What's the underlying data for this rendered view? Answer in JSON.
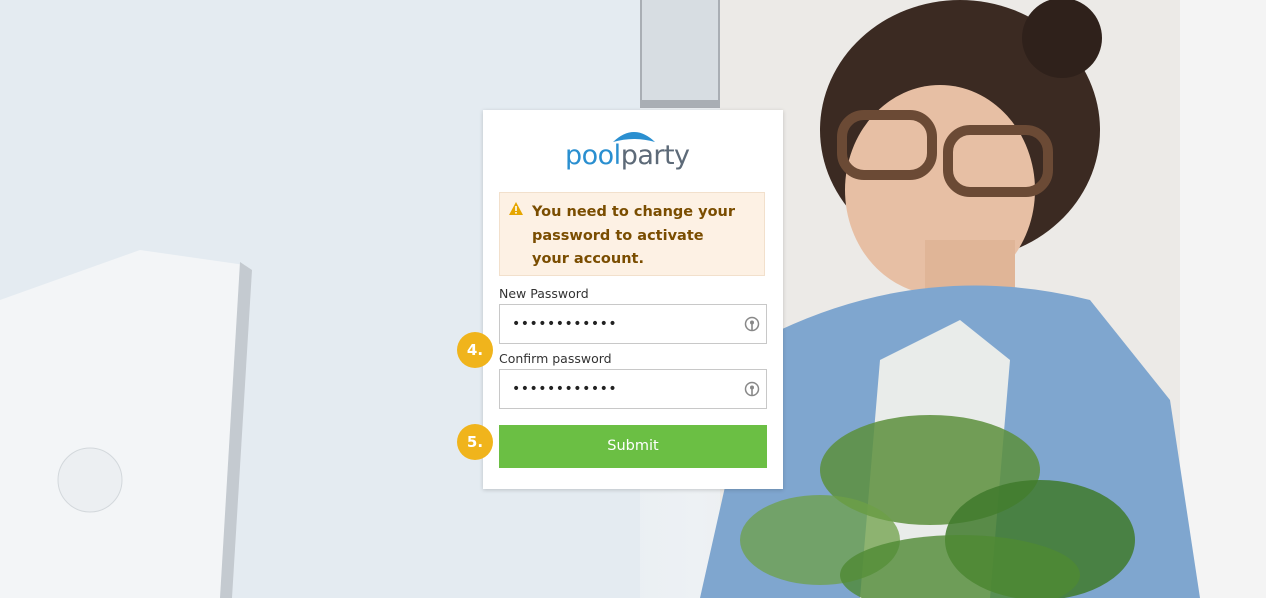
{
  "logo": {
    "text_pool": "pool",
    "text_party": "party",
    "colors": {
      "pool": "#2a8fd0",
      "party": "#5d6a78"
    },
    "icon": "umbrella-icon"
  },
  "alert": {
    "icon": "warning-icon",
    "message": "You need to change your password to activate your account.",
    "background": "#fdf1e4",
    "text_color": "#7a4d00"
  },
  "form": {
    "new_password": {
      "label": "New Password",
      "value": "••••••••••••",
      "icon": "password-key-icon"
    },
    "confirm_password": {
      "label": "Confirm password",
      "value": "••••••••••••",
      "icon": "password-key-icon"
    },
    "submit_label": "Submit",
    "submit_color": "#6bbf44"
  },
  "steps": {
    "step4": "4.",
    "step5": "5.",
    "color": "#f0b41c"
  }
}
